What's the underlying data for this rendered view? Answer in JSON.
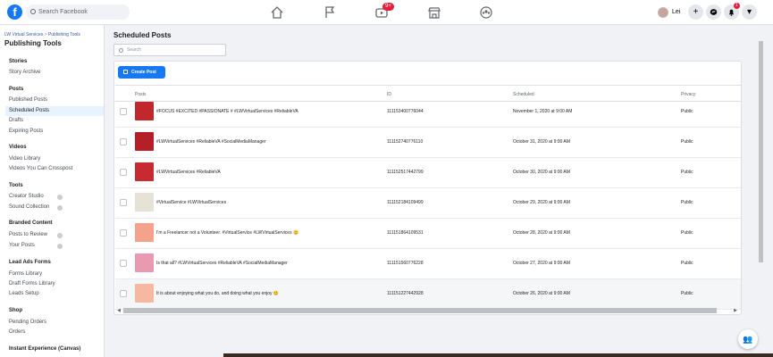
{
  "topbar": {
    "logo": "f",
    "search_placeholder": "Search Facebook",
    "nav_icons": [
      "home-icon",
      "flag-icon",
      "watch-icon",
      "marketplace-icon",
      "groups-icon"
    ],
    "watch_badge": "9+",
    "user_name": "Lei",
    "create_symbol": "+",
    "notification_badge": "1",
    "menu_symbol": "▾"
  },
  "sidebar": {
    "breadcrumb": {
      "parent": "LW Virtual Services",
      "separator": ">",
      "current": "Publishing Tools"
    },
    "title": "Publishing Tools",
    "sections": [
      {
        "heading": "Stories",
        "items": [
          "Story Archive"
        ]
      },
      {
        "heading": "Posts",
        "items": [
          "Published Posts",
          "Scheduled Posts",
          "Drafts",
          "Expiring Posts"
        ]
      },
      {
        "heading": "Videos",
        "items": [
          "Video Library",
          "Videos You Can Crosspost"
        ]
      },
      {
        "heading": "Tools",
        "items": [
          "Creator Studio",
          "Sound Collection"
        ]
      },
      {
        "heading": "Branded Content",
        "items": [
          "Posts to Review",
          "Your Posts"
        ]
      },
      {
        "heading": "Lead Ads Forms",
        "items": [
          "Forms Library",
          "Draft Forms Library",
          "Leads Setup"
        ]
      },
      {
        "heading": "Shop",
        "items": [
          "Pending Orders",
          "Orders"
        ]
      },
      {
        "heading": "Instant Experience (Canvas)",
        "items": []
      }
    ],
    "active_item": "Scheduled Posts"
  },
  "main": {
    "title": "Scheduled Posts",
    "search_placeholder": "Search",
    "create_button": "Create Post",
    "columns": [
      "Posts",
      "ID",
      "Scheduled",
      "Privacy"
    ],
    "rows": [
      {
        "text": "#FOCUS #EXCITED #PASSIONATE # #LWVirtualServices #ReliableVA",
        "id": "111153400776044",
        "scheduled": "November 1, 2020 at 9:00 AM",
        "privacy": "Public",
        "thumb_color": "#c0282d"
      },
      {
        "text": "#LWVirtualServices #ReliableVA #SocialMediaManager",
        "id": "111152740776110",
        "scheduled": "October 31, 2020 at 9:00 AM",
        "privacy": "Public",
        "thumb_color": "#b51f28"
      },
      {
        "text": "#LWVirtualServices #ReliableVA",
        "id": "111152517442799",
        "scheduled": "October 30, 2020 at 9:00 AM",
        "privacy": "Public",
        "thumb_color": "#c72a30"
      },
      {
        "text": "#VirtualService #LWVirtualServices",
        "id": "111152184109499",
        "scheduled": "October 29, 2020 at 9:00 AM",
        "privacy": "Public",
        "thumb_color": "#e7e2d6"
      },
      {
        "text": "I'm a Freelancer not a Volunteer. #VirtualService #LWVirtualServices 😊",
        "id": "111151864109531",
        "scheduled": "October 28, 2020 at 9:00 AM",
        "privacy": "Public",
        "thumb_color": "#f4a28c"
      },
      {
        "text": "Is that all? #LWVirtualServices #ReliableVA #SocialMediaManager",
        "id": "111151560776228",
        "scheduled": "October 27, 2020 at 9:00 AM",
        "privacy": "Public",
        "thumb_color": "#e89ab0"
      },
      {
        "text": "It is about enjoying what you do, and doing what you enjoy 😊",
        "id": "111151227442928",
        "scheduled": "October 26, 2020 at 9:00 AM",
        "privacy": "Public",
        "thumb_color": "#f6b8a0"
      }
    ]
  },
  "colors": {
    "brand": "#1877f2",
    "badge": "#e41e3f"
  }
}
